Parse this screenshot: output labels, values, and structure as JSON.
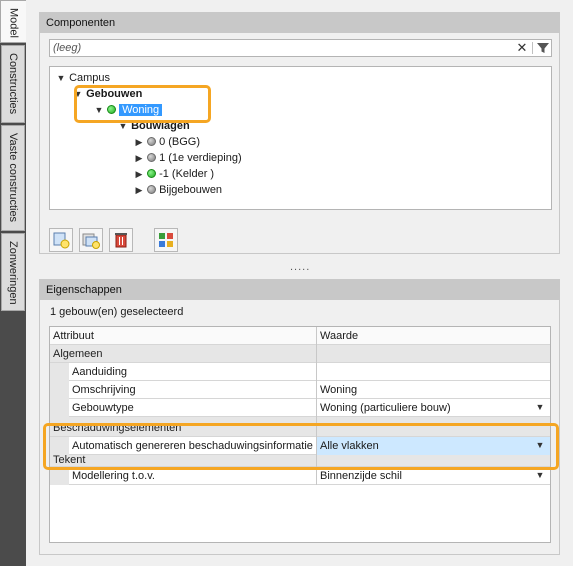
{
  "tabs": [
    {
      "label": "Model"
    },
    {
      "label": "Constructies"
    },
    {
      "label": "Vaste constructies"
    },
    {
      "label": "Zonweringen"
    }
  ],
  "components": {
    "title": "Componenten",
    "search_placeholder": "(leeg)",
    "tree": {
      "campus": "Campus",
      "gebouwen": "Gebouwen",
      "woning": "Woning",
      "bouwlagen": "Bouwlagen",
      "layers": [
        "0 (BGG)",
        "1 (1e verdieping)",
        "-1 (Kelder )",
        "Bijgebouwen"
      ]
    },
    "splitter": "....."
  },
  "properties": {
    "title": "Eigenschappen",
    "selection_count": "1 gebouw(en) geselecteerd",
    "col_attr": "Attribuut",
    "col_value": "Waarde",
    "cat_general": "Algemeen",
    "aanduiding_label": "Aanduiding",
    "aanduiding_value": "",
    "omschrijving_label": "Omschrijving",
    "omschrijving_value": "Woning",
    "gebouwtype_label": "Gebouwtype",
    "gebouwtype_value": "Woning (particuliere bouw)",
    "cat_shading": "Beschaduwingselementen",
    "auto_shading_label": "Automatisch genereren beschaduwingsinformatie",
    "auto_shading_value": "Alle vlakken",
    "cat_drawing": "Tekent",
    "modelling_label": "Modellering t.o.v.",
    "modelling_value": "Binnenzijde schil"
  },
  "colors": {
    "highlight": "#f5a623",
    "selection": "#3399ff",
    "tab_strip": "#4b4b4b"
  }
}
